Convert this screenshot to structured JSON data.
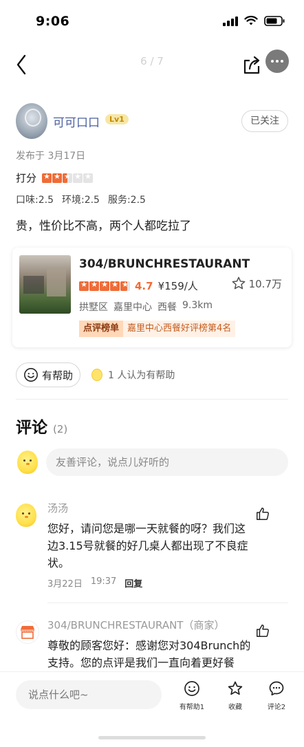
{
  "status_bar": {
    "time": "9:06"
  },
  "nav": {
    "page_indicator": "6 / 7"
  },
  "author": {
    "name": "可可口口",
    "level": "Lv1",
    "follow_label": "已关注"
  },
  "review": {
    "publish_time": "发布于 3月17日",
    "score_label": "打分",
    "score_stars": 2.5,
    "subscores": [
      "口味:2.5",
      "环境:2.5",
      "服务:2.5"
    ],
    "text": "贵，性价比不高，两个人都吃拉了"
  },
  "shop": {
    "name": "304/BRUNCHRESTAURANT",
    "rating_stars": 4.7,
    "rating": "4.7",
    "price": "¥159/人",
    "favorites": "10.7万",
    "district": "拱墅区",
    "area": "嘉里中心",
    "category": "西餐",
    "distance": "9.3km",
    "rank_tag": "点评榜单",
    "rank_text": "嘉里中心西餐好评榜第4名"
  },
  "helpful": {
    "button_label": "有帮助",
    "count_text": "1 人认为有帮助"
  },
  "comments": {
    "title": "评论",
    "count": "(2)",
    "input_placeholder": "友善评论，说点儿好听的",
    "items": [
      {
        "user": "汤汤",
        "text": "您好，请问您是哪一天就餐的呀？我们这边3.15号就餐的好几桌人都出现了不良症状。",
        "date": "3月22日",
        "time": "19:37",
        "reply_label": "回复"
      },
      {
        "user": "304/BRUNCHRESTAURANT（商家）",
        "text": "尊敬的顾客您好：感谢您对304Brunch的支持。您的点评是我们一直向着更好餐"
      }
    ]
  },
  "bottom_bar": {
    "input_placeholder": "说点什么吧~",
    "helpful_label": "有帮助1",
    "favorite_label": "收藏",
    "comment_label": "评论2"
  }
}
